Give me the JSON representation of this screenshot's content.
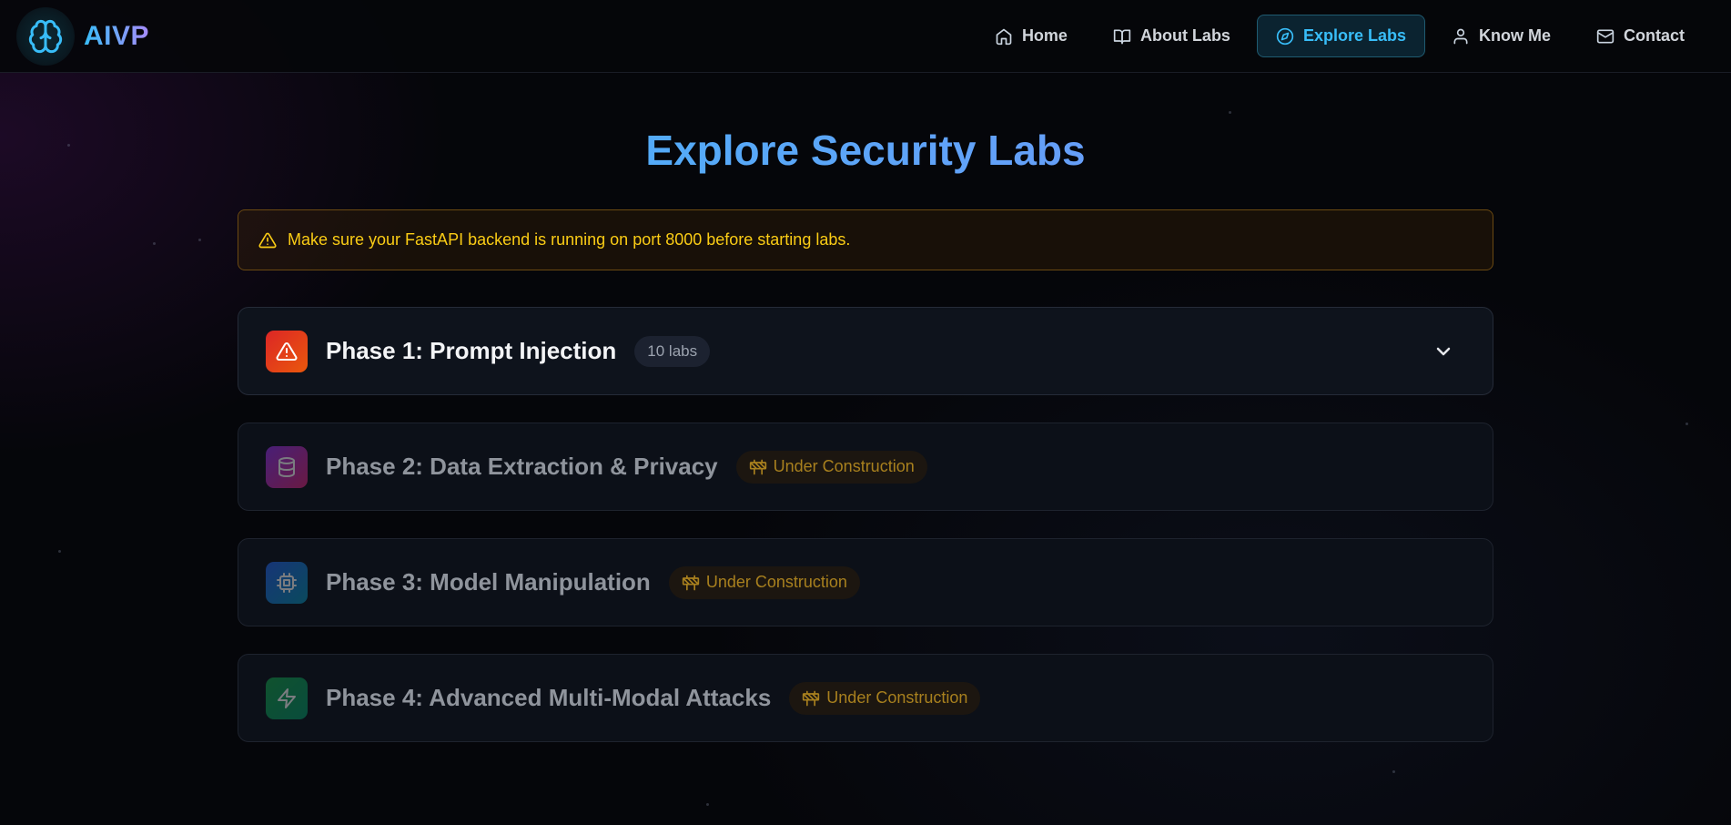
{
  "brand": {
    "name": "AIVP",
    "logo_icon": "brain-icon"
  },
  "nav": {
    "items": [
      {
        "label": "Home",
        "icon": "home-icon",
        "active": false
      },
      {
        "label": "About Labs",
        "icon": "book-icon",
        "active": false
      },
      {
        "label": "Explore Labs",
        "icon": "compass-icon",
        "active": true
      },
      {
        "label": "Know Me",
        "icon": "user-icon",
        "active": false
      },
      {
        "label": "Contact",
        "icon": "mail-icon",
        "active": false
      }
    ]
  },
  "page": {
    "title": "Explore Security Labs",
    "warning": "Make sure your FastAPI backend is running on port 8000 before starting labs."
  },
  "phases": [
    {
      "title": "Phase 1: Prompt Injection",
      "badge": "10 labs",
      "icon": "alert-triangle-icon",
      "status": "available",
      "expanded": false
    },
    {
      "title": "Phase 2: Data Extraction & Privacy",
      "badge": "Under Construction",
      "icon": "database-icon",
      "status": "under-construction"
    },
    {
      "title": "Phase 3: Model Manipulation",
      "badge": "Under Construction",
      "icon": "cpu-icon",
      "status": "under-construction"
    },
    {
      "title": "Phase 4: Advanced Multi-Modal Attacks",
      "badge": "Under Construction",
      "icon": "zap-icon",
      "status": "under-construction"
    }
  ],
  "colors": {
    "accent": "#38bdf8",
    "warning": "#facc15",
    "phase1_icon": "#ea580c",
    "phase2_icon": "#7e3fa0",
    "phase3_icon": "#1e6fa8",
    "phase4_icon": "#15803d",
    "construction": "#a8801e"
  }
}
